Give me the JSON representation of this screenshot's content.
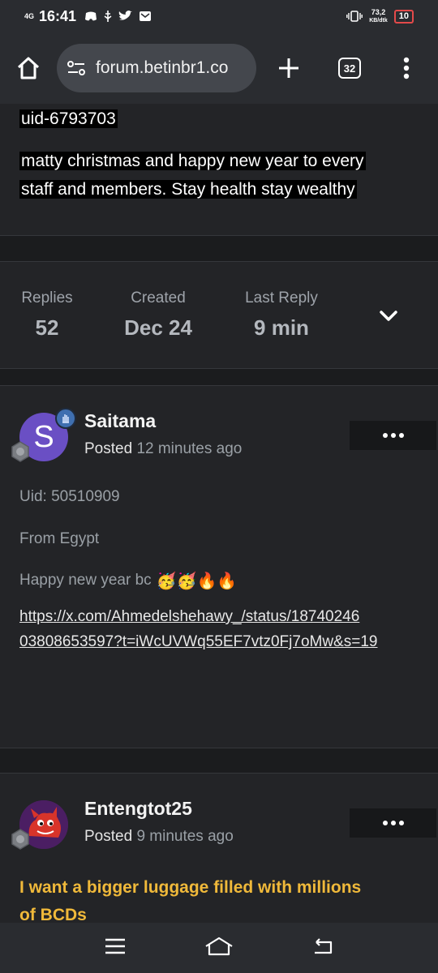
{
  "status_bar": {
    "network": "4G",
    "time": "16:41",
    "speed": "73,2",
    "speed_unit": "KB/dtk",
    "battery": "10"
  },
  "browser": {
    "url": "forum.betinbr1.co",
    "tab_count": "32"
  },
  "top_post": {
    "line1": "uid-6793703",
    "line2": "matty christmas and happy new year to every",
    "line3": "staff and members. Stay health stay wealthy"
  },
  "stats": {
    "replies_label": "Replies",
    "replies_value": "52",
    "created_label": "Created",
    "created_value": "Dec 24",
    "last_reply_label": "Last Reply",
    "last_reply_value": "9 min"
  },
  "post1": {
    "avatar_letter": "S",
    "author": "Saitama",
    "posted_label": "Posted",
    "posted_time": "12 minutes ago",
    "uid": "Uid: 50510909",
    "from": "From Egypt",
    "greeting": "Happy new year bc",
    "emojis": "🥳🥳🔥🔥",
    "link_line1": "https://x.com/Ahmedelshehawy_/status/18740246",
    "link_line2": "03808653597?t=iWcUVWq55EF7vtz0Fj7oMw&s=19"
  },
  "post2": {
    "author": "Entengtot25",
    "posted_label": "Posted",
    "posted_time": "9 minutes ago",
    "text_line1": "I want a bigger luggage filled with millions",
    "text_line2": "of BCDs"
  },
  "colors": {
    "accent_yellow": "#f0b93a",
    "avatar_purple": "#6a4fc4",
    "badge_blue": "#3f6fb0",
    "background": "#1b1c1e",
    "card": "#232427"
  }
}
